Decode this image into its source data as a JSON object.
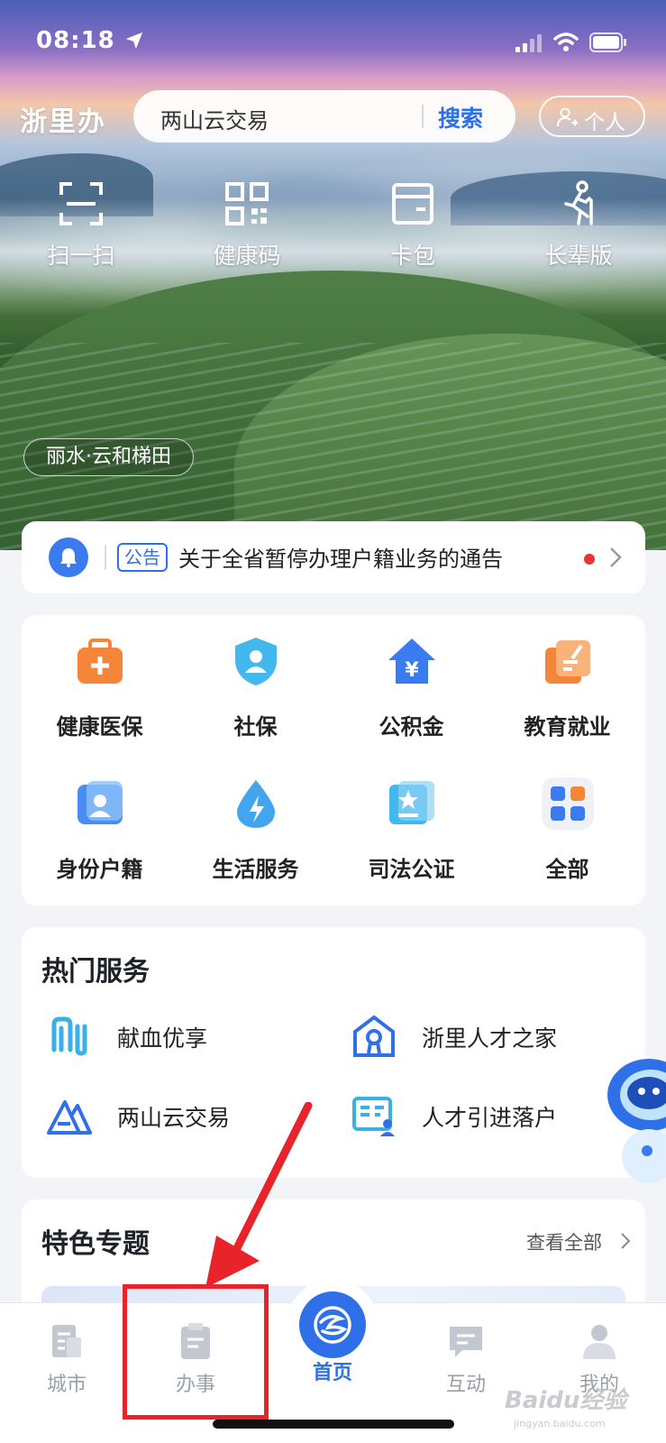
{
  "status_bar": {
    "time": "08:18"
  },
  "header": {
    "logo": "浙里办",
    "search_text": "两山云交易",
    "search_button": "搜索",
    "profile_button": "个人"
  },
  "quick_actions": [
    "扫一扫",
    "健康码",
    "卡包",
    "长辈版"
  ],
  "location_tag": "丽水·云和梯田",
  "notice": {
    "tag": "公告",
    "text": "关于全省暂停办理户籍业务的通告"
  },
  "services": [
    "健康医保",
    "社保",
    "公积金",
    "教育就业",
    "身份户籍",
    "生活服务",
    "司法公证",
    "全部"
  ],
  "hot_services": {
    "title": "热门服务",
    "items": [
      "献血优享",
      "浙里人才之家",
      "两山云交易",
      "人才引进落户"
    ]
  },
  "topics": {
    "title": "特色专题",
    "view_all": "查看全部"
  },
  "tabs": [
    "城市",
    "办事",
    "首页",
    "互动",
    "我的"
  ],
  "watermark": {
    "brand": "Baidu经验",
    "url": "jingyan.baidu.com"
  },
  "colors": {
    "accent": "#2f6fe8",
    "highlight": "#e8242a",
    "notice_dot": "#e8333a"
  }
}
